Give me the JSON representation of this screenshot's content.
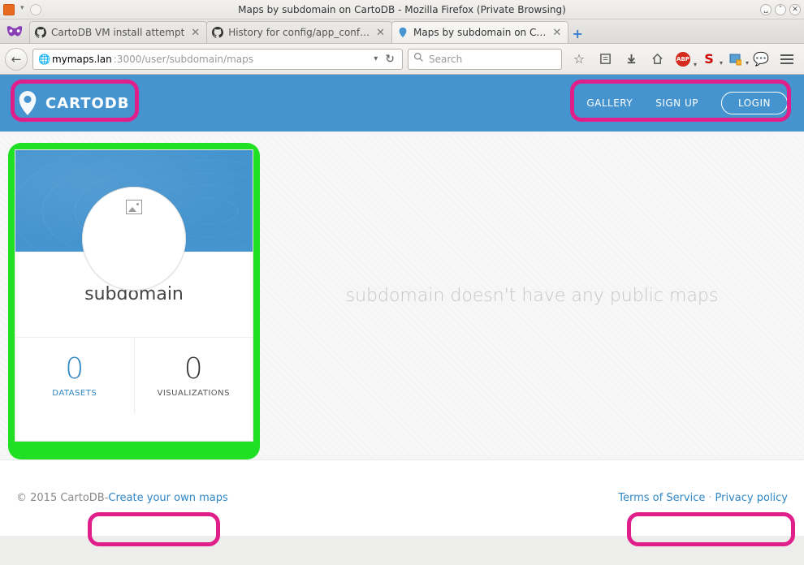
{
  "window": {
    "title": "Maps by subdomain on CartoDB - Mozilla Firefox (Private Browsing)"
  },
  "tabs": [
    {
      "label": "CartoDB VM install attempt",
      "active": false,
      "favicon": "github"
    },
    {
      "label": "History for config/app_conf…",
      "active": false,
      "favicon": "github"
    },
    {
      "label": "Maps by subdomain on C…",
      "active": true,
      "favicon": "cartodb"
    }
  ],
  "url": {
    "host": "mymaps.lan",
    "rest": ":3000/user/subdomain/maps"
  },
  "search": {
    "placeholder": "Search"
  },
  "header": {
    "brand": "CARTODB",
    "gallery": "GALLERY",
    "signup": "SIGN UP",
    "login": "LOGIN"
  },
  "profile": {
    "name": "subdomain",
    "datasets_count": "0",
    "datasets_label": "DATASETS",
    "viz_count": "0",
    "viz_label": "VISUALIZATIONS"
  },
  "empty_message": "subdomain doesn't have any public maps",
  "footer": {
    "copyright": "© 2015 CartoDB",
    "dash": " - ",
    "create": "Create your own maps",
    "tos": "Terms of Service",
    "dot": " · ",
    "privacy": "Privacy policy"
  }
}
